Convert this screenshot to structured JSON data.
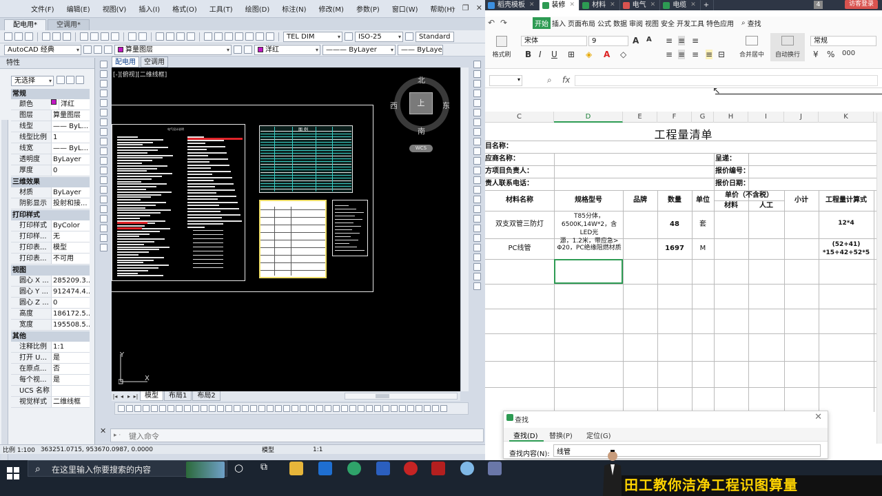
{
  "cad": {
    "menu": [
      "文件(F)",
      "编辑(E)",
      "视图(V)",
      "插入(I)",
      "格式(O)",
      "工具(T)",
      "绘图(D)",
      "标注(N)",
      "修改(M)",
      "参数(P)",
      "窗口(W)",
      "帮助(H)"
    ],
    "doc_tabs": [
      "配电用*",
      "空调用*"
    ],
    "toolbar1": {
      "dimstyle": "TEL DIM",
      "dimscale": "ISO-25",
      "textstyle": "Standard"
    },
    "toolbar2": {
      "workspace": "AutoCAD 经典",
      "layer": "算量图层",
      "color": "洋红",
      "linetype": "ByLayer",
      "lineweight": "ByLayer"
    },
    "props": {
      "title": "特性",
      "selection": "无选择",
      "sections": [
        {
          "name": "常规",
          "rows": [
            [
              "颜色",
              "洋红"
            ],
            [
              "图层",
              "算量图层"
            ],
            [
              "线型",
              "—— ByL..."
            ],
            [
              "线型比例",
              "1"
            ],
            [
              "线宽",
              "—— ByL..."
            ],
            [
              "透明度",
              "ByLayer"
            ],
            [
              "厚度",
              "0"
            ]
          ]
        },
        {
          "name": "三维效果",
          "rows": [
            [
              "材质",
              "ByLayer"
            ],
            [
              "阴影显示",
              "投射和接..."
            ]
          ]
        },
        {
          "name": "打印样式",
          "rows": [
            [
              "打印样式",
              "ByColor"
            ],
            [
              "打印样...",
              "无"
            ],
            [
              "打印表...",
              "模型"
            ],
            [
              "打印表...",
              "不可用"
            ]
          ]
        },
        {
          "name": "视图",
          "rows": [
            [
              "圆心 X ...",
              "285209.3..."
            ],
            [
              "圆心 Y ...",
              "912474.4..."
            ],
            [
              "圆心 Z ...",
              "0"
            ],
            [
              "高度",
              "186172.5..."
            ],
            [
              "宽度",
              "195508.5..."
            ]
          ]
        },
        {
          "name": "其他",
          "rows": [
            [
              "注释比例",
              "1:1"
            ],
            [
              "打开 U...",
              "是"
            ],
            [
              "在原点...",
              "否"
            ],
            [
              "每个视...",
              "是"
            ],
            [
              "UCS 名称",
              ""
            ],
            [
              "视觉样式",
              "二维线框"
            ]
          ]
        }
      ]
    },
    "drawing_tabs": [
      "配电用",
      "空调用"
    ],
    "viewport_label": "[-][俯视][二维线框]",
    "compass": {
      "n": "北",
      "s": "南",
      "e": "东",
      "w": "西",
      "face": "上",
      "wcs": "WCS"
    },
    "sheet_titles": {
      "legend": "图 例",
      "design": "电气设计说明"
    },
    "ucs": {
      "y": "Y",
      "x": "X"
    },
    "layout_tabs": [
      "模型",
      "布局1",
      "布局2"
    ],
    "command_placeholder": "键入命令",
    "status": {
      "scale": "比例 1:100",
      "coords": "363251.0715, 953670.0987, 0.0000",
      "space": "模型",
      "anno": "1:1"
    }
  },
  "excel": {
    "tabs": [
      {
        "label": "稻壳模板",
        "color": "#3c8fe0"
      },
      {
        "label": "装修",
        "color": "#2d9b53",
        "active": true
      },
      {
        "label": "材料",
        "color": "#2d9b53"
      },
      {
        "label": "电气",
        "color": "#d9534f"
      },
      {
        "label": "电缆",
        "color": "#2d9b53"
      }
    ],
    "tab_count": "4",
    "login": "访客登录",
    "menu": [
      "开始",
      "插入",
      "页面布局",
      "公式",
      "数据",
      "审阅",
      "视图",
      "安全",
      "开发工具",
      "特色应用"
    ],
    "search": "查找",
    "ribbon": {
      "font": "宋体",
      "size": "9",
      "format_painter": "格式刷",
      "merge": "合并居中",
      "wrap": "自动换行",
      "number_format": "常规",
      "bold": "B",
      "italic": "I",
      "underline": "U"
    },
    "formula_fx": "fx",
    "columns": [
      {
        "label": "C",
        "w": 100
      },
      {
        "label": "D",
        "w": 100,
        "sel": true
      },
      {
        "label": "E",
        "w": 50
      },
      {
        "label": "F",
        "w": 50
      },
      {
        "label": "G",
        "w": 32
      },
      {
        "label": "H",
        "w": 50
      },
      {
        "label": "I",
        "w": 52
      },
      {
        "label": "J",
        "w": 50
      },
      {
        "label": "K",
        "w": 80
      }
    ],
    "sheet_title": "工程量清单",
    "info_rows": [
      {
        "left": "目名称：",
        "right": ""
      },
      {
        "left": "应商名称：",
        "right": "呈递："
      },
      {
        "left": "方项目负责人：",
        "right": "报价编号："
      },
      {
        "left": "责人联系电话：",
        "right": "报价日期："
      }
    ],
    "headers": {
      "name": "材料名称",
      "spec": "规格型号",
      "brand": "品牌",
      "qty": "数量",
      "unit": "单位",
      "price": "单价（不含税）",
      "material": "材料",
      "labor": "人工",
      "subtotal": "小计",
      "formula": "工程量计算式"
    },
    "rows": [
      {
        "name": "双支双管三防灯",
        "spec": [
          "T85分体，",
          "6500K,14W*2，含LED光",
          "源，1.2米，带应急>"
        ],
        "qty": "48",
        "unit": "套",
        "formula": [
          "12*4"
        ]
      },
      {
        "name": "PC线管",
        "spec": [
          "Φ20，PC绝缘阻燃材质"
        ],
        "qty": "1697",
        "unit": "M",
        "formula": [
          "(52+41)",
          "*15+42+52*5"
        ]
      }
    ],
    "find": {
      "title": "查找",
      "tabs": [
        "查找(D)",
        "替换(P)",
        "定位(G)"
      ],
      "label": "查找内容(N):",
      "value": "线管"
    },
    "side_note": "58"
  },
  "taskbar": {
    "search_text": "在这里输入你要搜索的内容"
  },
  "banner": "田工教你洁净工程识图算量"
}
